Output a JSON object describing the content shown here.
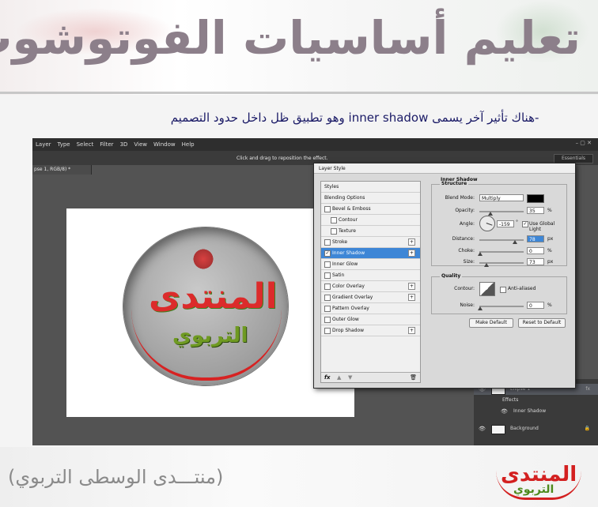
{
  "banner": {
    "title": "تعليم أساسيات الفوتوشوب"
  },
  "caption": {
    "dash": "-",
    "text": "هناك تأثير آخر يسمى inner shadow وهو تطبيق ظل داخل حدود التصميم"
  },
  "photoshop": {
    "menu": [
      "Layer",
      "Type",
      "Select",
      "Filter",
      "3D",
      "View",
      "Window",
      "Help"
    ],
    "options_hint": "Click and drag to reposition the effect.",
    "workspace": "Essentials",
    "window_controls": "–  ▢  ✕",
    "doc_tab": "pse 1, RGB/8) *",
    "layers": [
      {
        "eye": "👁",
        "name": "Ellipse 1",
        "fx": "fx"
      },
      {
        "eye": "",
        "name": "Effects",
        "fx": ""
      },
      {
        "eye": "👁",
        "name": "Inner Shadow",
        "fx": ""
      },
      {
        "eye": "👁",
        "name": "Background",
        "fx": ""
      }
    ]
  },
  "canvas_logo": {
    "top": "المنتدى",
    "bottom": "التربوي"
  },
  "dialog": {
    "title": "Layer Style",
    "styles": [
      {
        "label": "Styles"
      },
      {
        "label": "Blending Options"
      },
      {
        "label": "Bevel & Emboss"
      },
      {
        "label": "Contour"
      },
      {
        "label": "Texture"
      },
      {
        "label": "Stroke"
      },
      {
        "label": "Inner Shadow",
        "checked": "✓"
      },
      {
        "label": "Inner Glow"
      },
      {
        "label": "Satin"
      },
      {
        "label": "Color Overlay"
      },
      {
        "label": "Gradient Overlay"
      },
      {
        "label": "Pattern Overlay"
      },
      {
        "label": "Outer Glow"
      },
      {
        "label": "Drop Shadow"
      }
    ],
    "plus": "+",
    "footer_icons": {
      "fx": "fx",
      "up": "▲",
      "down": "▼",
      "trash": "🗑"
    },
    "inner_shadow": {
      "title": "Inner Shadow",
      "structure": "Structure",
      "blend_mode_label": "Blend Mode:",
      "blend_mode": "Multiply",
      "opacity_label": "Opacity:",
      "opacity": "35",
      "angle_label": "Angle:",
      "angle": "-159",
      "degree": "°",
      "use_global_light": "Use Global Light",
      "distance_label": "Distance:",
      "distance": "78",
      "choke_label": "Choke:",
      "choke": "0",
      "size_label": "Size:",
      "size": "73",
      "percent": "%",
      "px": "px"
    },
    "quality": {
      "title": "Quality",
      "contour_label": "Contour:",
      "anti_aliased": "Anti-aliased",
      "noise_label": "Noise:",
      "noise": "0",
      "percent": "%"
    },
    "buttons": {
      "make_default": "Make Default",
      "reset_to_default": "Reset to Default"
    }
  },
  "footer": {
    "forum_text": "(منتـــدى الوسطى التربوي)",
    "logo_top": "المنتدى",
    "logo_bottom": "التربوي"
  }
}
